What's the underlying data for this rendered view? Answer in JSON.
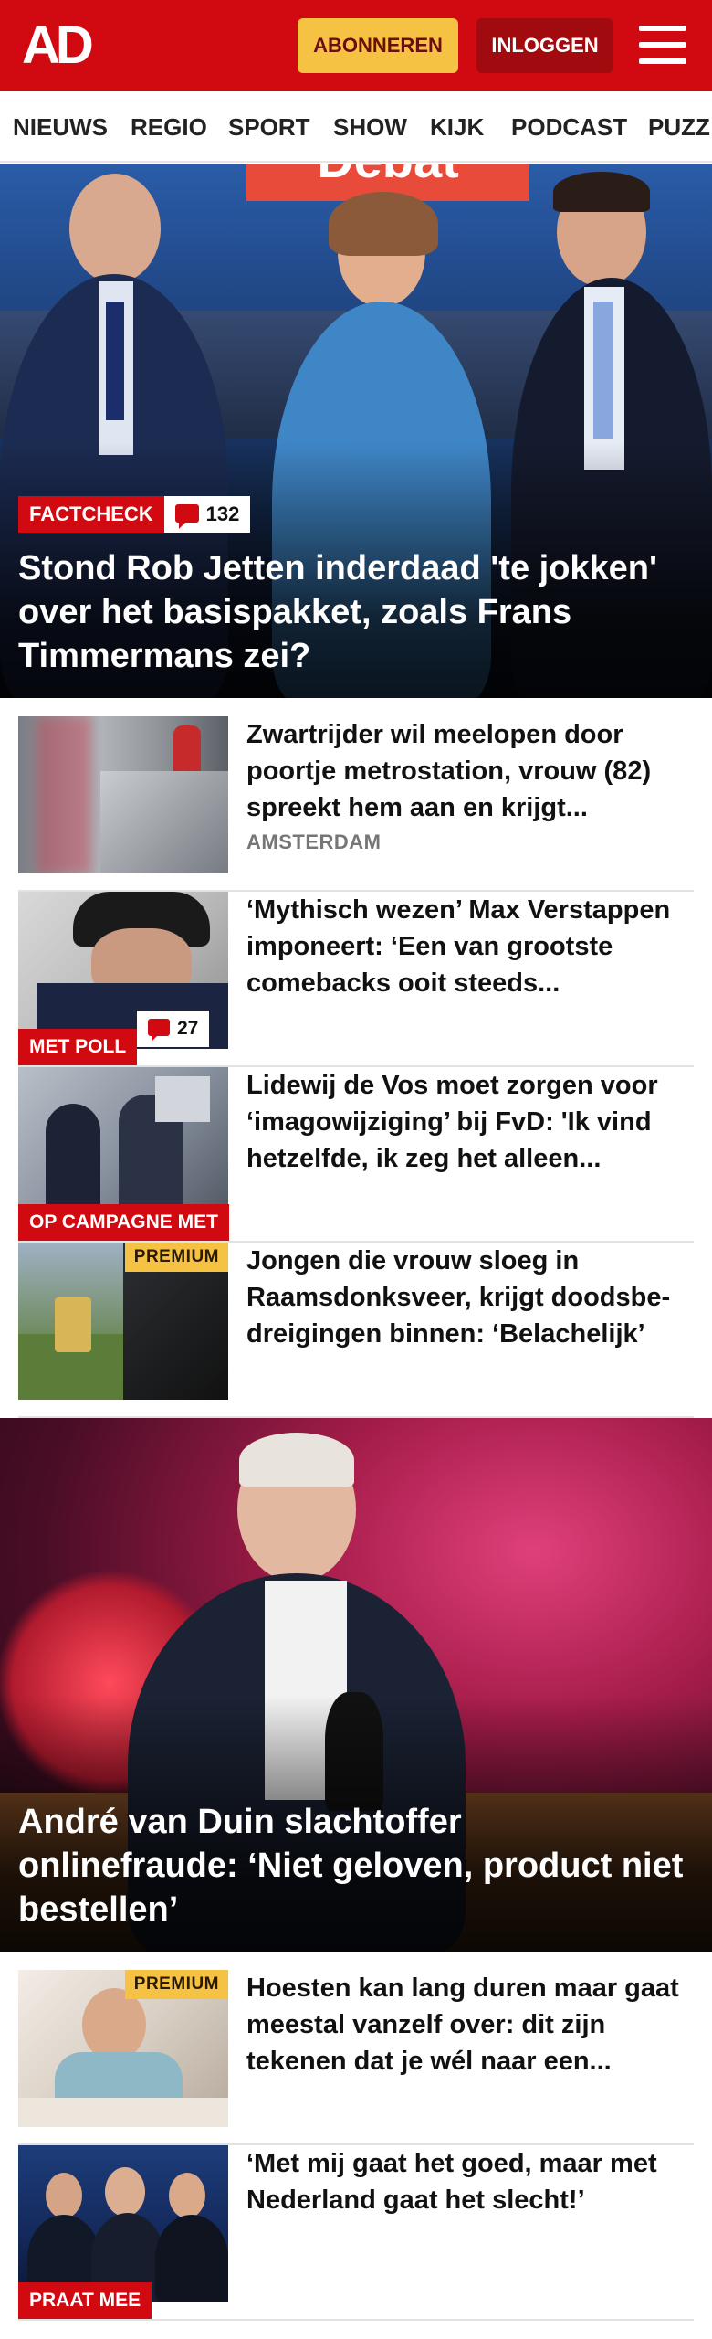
{
  "header": {
    "logo": "AD",
    "subscribe_label": "ABONNEREN",
    "login_label": "INLOGGEN",
    "menu_icon": "hamburger-menu-icon",
    "brand_color": "#d10a11",
    "accent_color": "#f6c244"
  },
  "nav": {
    "items": [
      "NIEUWS",
      "REGIO",
      "SPORT",
      "SHOW",
      "KIJK",
      "PODCAST",
      "PUZZ"
    ]
  },
  "hero": {
    "tag": "FACTCHECK",
    "comments": "132",
    "title": "Stond Rob Jetten inderdaad 'te jokken' over het basispakket, zoals Frans Timmermans zei?",
    "background_sign": "Debat"
  },
  "articles": [
    {
      "title": "Zwartrijder wil meelopen door poortje metrostation, vrouw (82) spreekt hem aan en krijgt...",
      "meta": "AMSTERDAM"
    },
    {
      "title": "‘Mythisch wezen’ Max Verstappen imponeert: ‘Een van grootste comebacks ooit steeds...",
      "label": "MET POLL",
      "comments": "27"
    },
    {
      "title": "Lidewij de Vos moet zorgen voor ‘imagowijziging’ bij FvD: 'Ik vind hetzelfde, ik zeg het alleen...",
      "label": "OP CAMPAGNE MET"
    },
    {
      "title": "Jongen die vrouw sloeg in Raamsdonksveer, krijgt doodsbe­dreigingen binnen: ‘Belachelijk’",
      "premium": "PREMIUM"
    }
  ],
  "hero2": {
    "title": "André van Duin slachtoffer onlinefraude: ‘Niet geloven, product niet bestellen’"
  },
  "articles2": [
    {
      "title": "Hoesten kan lang duren maar gaat meestal vanzelf over: dit zijn tekenen dat je wél naar een...",
      "premium": "PREMIUM"
    },
    {
      "title": "‘Met mij gaat het goed, maar met Nederland gaat het slecht!’",
      "label": "PRAAT MEE"
    }
  ]
}
